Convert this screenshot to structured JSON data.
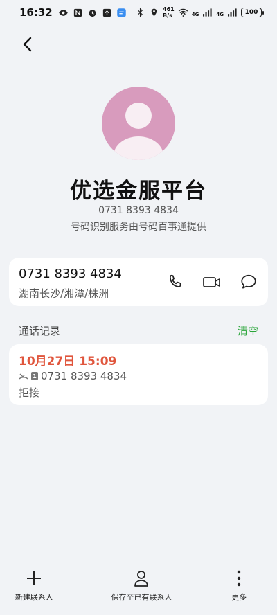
{
  "status_bar": {
    "time": "16:32",
    "network_speed": "461\nB/s",
    "battery": "100",
    "signal_1": "4G",
    "signal_2": "4G"
  },
  "contact": {
    "name": "优选金服平台",
    "number": "0731 8393 4834",
    "provider_note": "号码识别服务由号码百事通提供"
  },
  "number_card": {
    "number": "0731 8393 4834",
    "location": "湖南长沙/湘潭/株洲"
  },
  "call_log": {
    "title": "通话记录",
    "clear_label": "清空",
    "entries": [
      {
        "date": "10月27日 15:09",
        "sim": "1",
        "number": "0731 8393 4834",
        "status": "拒接"
      }
    ]
  },
  "bottom_bar": {
    "new_contact": "新建联系人",
    "save_existing": "保存至已有联系人",
    "more": "更多"
  },
  "colors": {
    "accent_green": "#2aa53a",
    "date_red": "#e0553c",
    "avatar_pink": "#d89bbd"
  }
}
